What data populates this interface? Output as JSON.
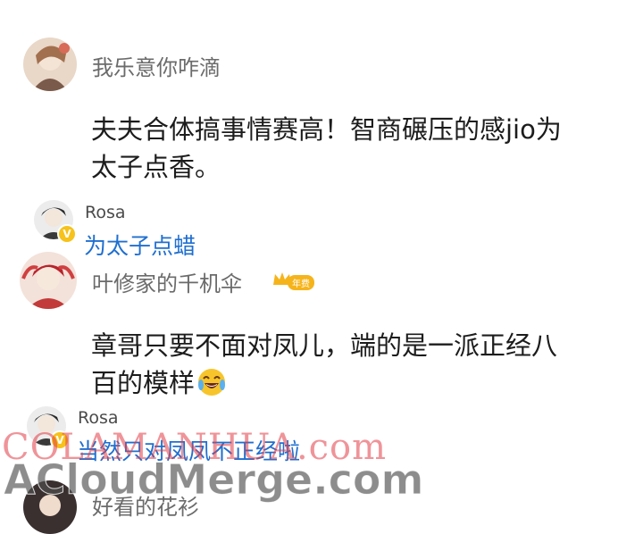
{
  "comments": [
    {
      "author": "我乐意你咋滴",
      "text_line1": "夫夫合体搞事情赛高！智商碾压的感jio为",
      "text_line2": "太子点香。",
      "reply": {
        "author": "Rosa",
        "text": "为太子点蜡"
      }
    },
    {
      "author": "叶修家的千机伞",
      "badge": "年费",
      "text_line1": "章哥只要不面对凤儿，端的是一派正经八",
      "text_line2": "百的模样",
      "emoji": "laughing-tears-emoji",
      "reply": {
        "author": "Rosa",
        "text": "当然只对凤凤不正经啦"
      }
    }
  ],
  "partial_next_author": "好看的花衫",
  "watermarks": {
    "top": "COLAMANHUA.com",
    "bottom": "ACloudMerge.com"
  },
  "colors": {
    "reply_link": "#1f6fd0",
    "vip_gold": "#f6c21b",
    "text": "#1c1c1c",
    "name": "#6b6b6b"
  }
}
